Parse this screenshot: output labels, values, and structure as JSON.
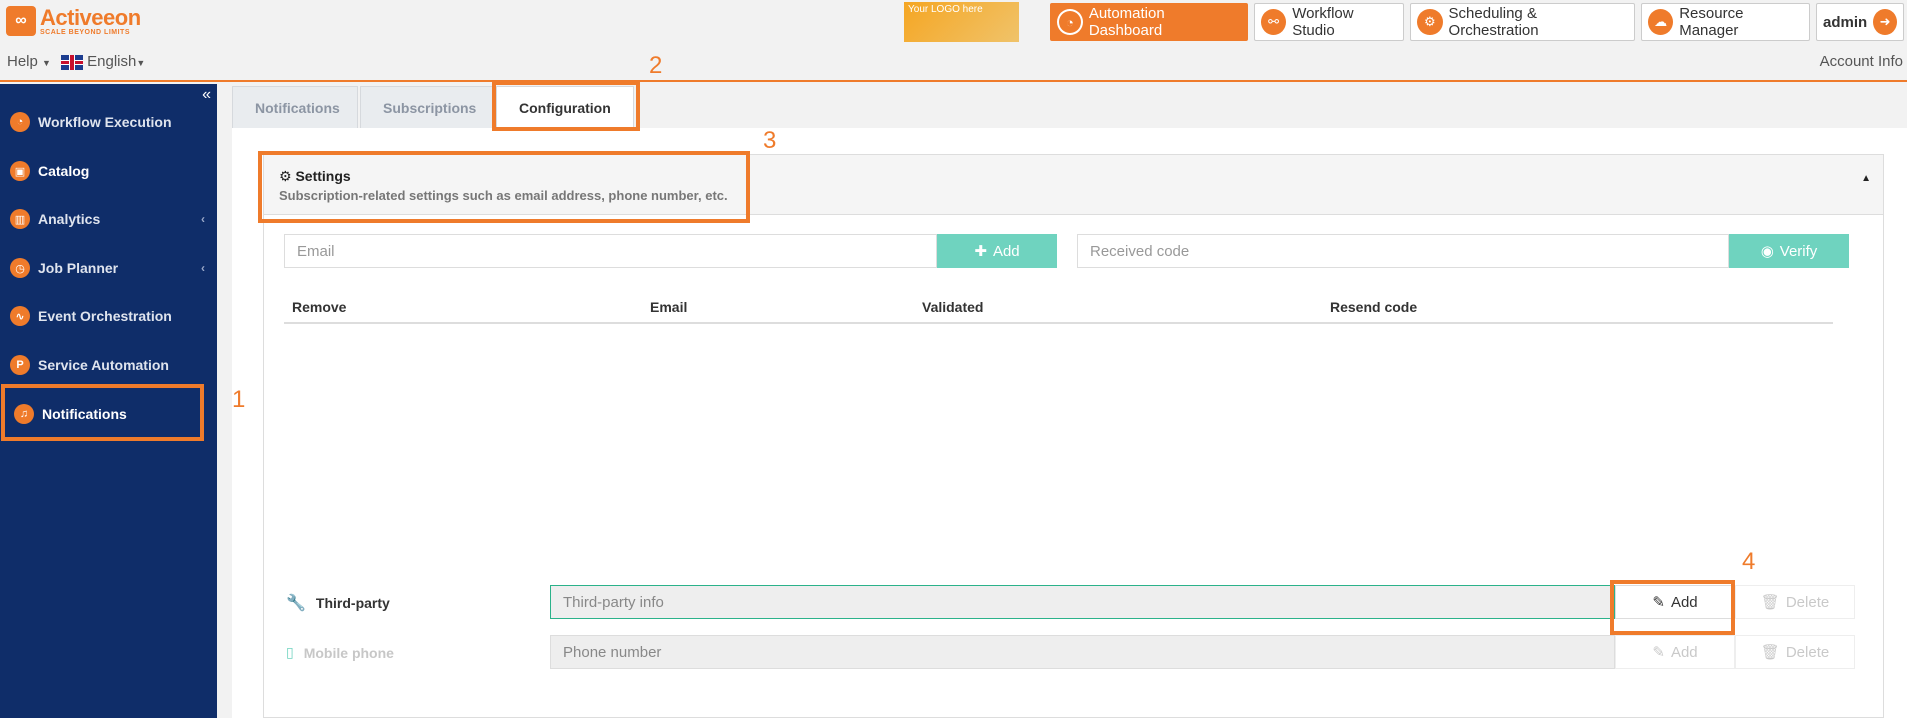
{
  "brand": {
    "name": "Activeeon",
    "tagline": "SCALE BEYOND LIMITS",
    "logo_placeholder": "Your LOGO here"
  },
  "header": {
    "help_label": "Help",
    "language_label": "English",
    "account_label": "Account Info",
    "nav": [
      {
        "label": "Automation Dashboard"
      },
      {
        "label": "Workflow Studio"
      },
      {
        "label": "Scheduling & Orchestration"
      },
      {
        "label": "Resource Manager"
      }
    ],
    "user_label": "admin"
  },
  "sidebar": {
    "items": [
      {
        "label": "Workflow Execution"
      },
      {
        "label": "Catalog"
      },
      {
        "label": "Analytics"
      },
      {
        "label": "Job Planner"
      },
      {
        "label": "Event Orchestration"
      },
      {
        "label": "Service Automation"
      },
      {
        "label": "Notifications"
      }
    ]
  },
  "tabs": [
    {
      "label": "Notifications"
    },
    {
      "label": "Subscriptions"
    },
    {
      "label": "Configuration"
    }
  ],
  "settings": {
    "title": "Settings",
    "subtitle": "Subscription-related settings such as email address, phone number, etc.",
    "email_placeholder": "Email",
    "add_label": "Add",
    "code_placeholder": "Received code",
    "verify_label": "Verify",
    "columns": [
      "Remove",
      "Email",
      "Validated",
      "Resend code"
    ],
    "third_party_label": "Third-party",
    "third_party_placeholder": "Third-party info",
    "mobile_label": "Mobile phone",
    "mobile_placeholder": "Phone number",
    "edit_add_label": "Add",
    "delete_label": "Delete"
  },
  "annotations": [
    "1",
    "2",
    "3",
    "4"
  ],
  "colors": {
    "accent": "#ef7b2b",
    "sidebar": "#0f2d69",
    "teal": "#6fd3bf"
  }
}
